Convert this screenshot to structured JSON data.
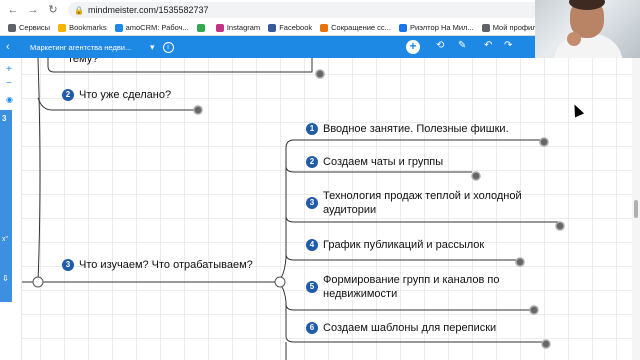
{
  "browser": {
    "url": "mindmeister.com/1535582737",
    "bookmarks": [
      {
        "label": "Сервисы",
        "color": "#5f6368"
      },
      {
        "label": "Bookmarks",
        "color": "#f4b400"
      },
      {
        "label": "amoCRM: Рабоч...",
        "color": "#1e88e5"
      },
      {
        "label": "",
        "color": "#34a853"
      },
      {
        "label": "Instagram",
        "color": "#c13584"
      },
      {
        "label": "Facebook",
        "color": "#3b5998"
      },
      {
        "label": "Сокращение сс...",
        "color": "#e8710a"
      },
      {
        "label": "Риэлтор На Мил...",
        "color": "#1a73e8"
      },
      {
        "label": "Мой профиль -...",
        "color": "#5f6368"
      }
    ]
  },
  "toolbar": {
    "back": "‹",
    "doc_title": "Маркетинг агентства недви...",
    "caret": "▾",
    "info": "i",
    "add": "+",
    "undo": "↶",
    "redo": "↷",
    "share": "⟲",
    "edit": "✎",
    "more": "⊘"
  },
  "rail": {
    "zoom_in": "+",
    "zoom_out": "−",
    "target": "◉",
    "tab_number": "3",
    "tab_text": "x\"",
    "tab_icon": "⇩"
  },
  "mindmap": {
    "top_fragment": "тему?",
    "branches": [
      {
        "num": "2",
        "text": "Что уже сделано?"
      },
      {
        "num": "3",
        "text": "Что изучаем? Что отрабатываем?"
      }
    ],
    "subtopics": [
      {
        "num": "1",
        "text": "Вводное занятие. Полезные фишки."
      },
      {
        "num": "2",
        "text": "Создаем чаты и группы"
      },
      {
        "num": "3",
        "text": "Технология продаж теплой и холодной аудитории"
      },
      {
        "num": "4",
        "text": "График публикаций и рассылок"
      },
      {
        "num": "5",
        "text": "Формирование групп и каналов по недвижимости"
      },
      {
        "num": "6",
        "text": "Создаем шаблоны для переписки"
      }
    ]
  },
  "colors": {
    "accent": "#1e88e5",
    "node_number": "#1f5ba8"
  }
}
